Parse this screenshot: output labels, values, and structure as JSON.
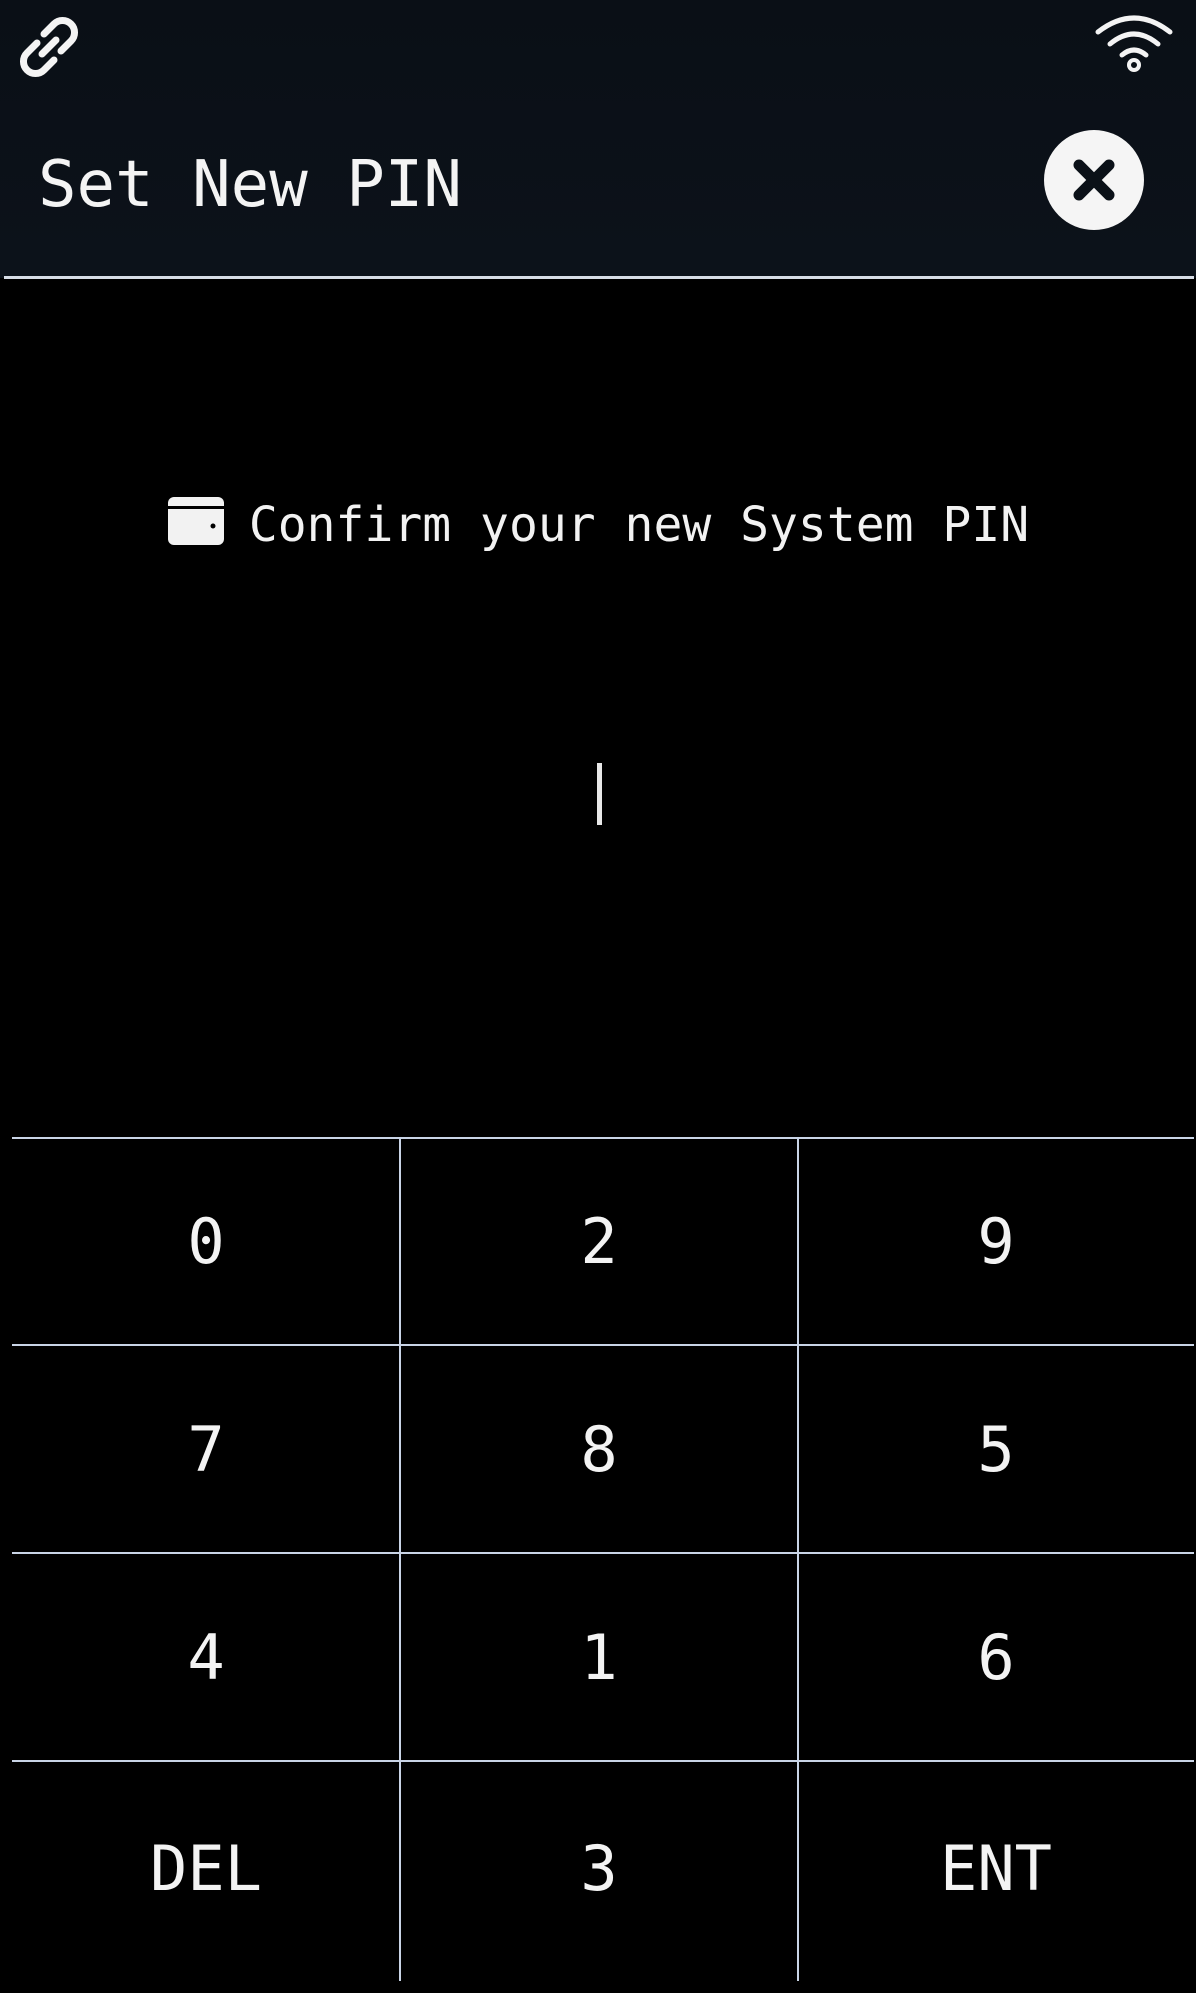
{
  "status_bar": {
    "left_icon": "link-icon",
    "right_icon": "wifi-icon"
  },
  "header": {
    "title": "Set New PIN",
    "close_icon": "close-icon"
  },
  "prompt": {
    "icon": "card-icon",
    "text": "Confirm your new System PIN"
  },
  "pin_entry": {
    "value": ""
  },
  "keypad": {
    "keys": [
      {
        "label": "0"
      },
      {
        "label": "2"
      },
      {
        "label": "9"
      },
      {
        "label": "7"
      },
      {
        "label": "8"
      },
      {
        "label": "5"
      },
      {
        "label": "4"
      },
      {
        "label": "1"
      },
      {
        "label": "6"
      },
      {
        "label": "DEL"
      },
      {
        "label": "3"
      },
      {
        "label": "ENT"
      }
    ]
  },
  "colors": {
    "background": "#000000",
    "header_background": "#0b1118",
    "foreground": "#f2f2f2",
    "grid_lines": "#c9d4e6"
  }
}
